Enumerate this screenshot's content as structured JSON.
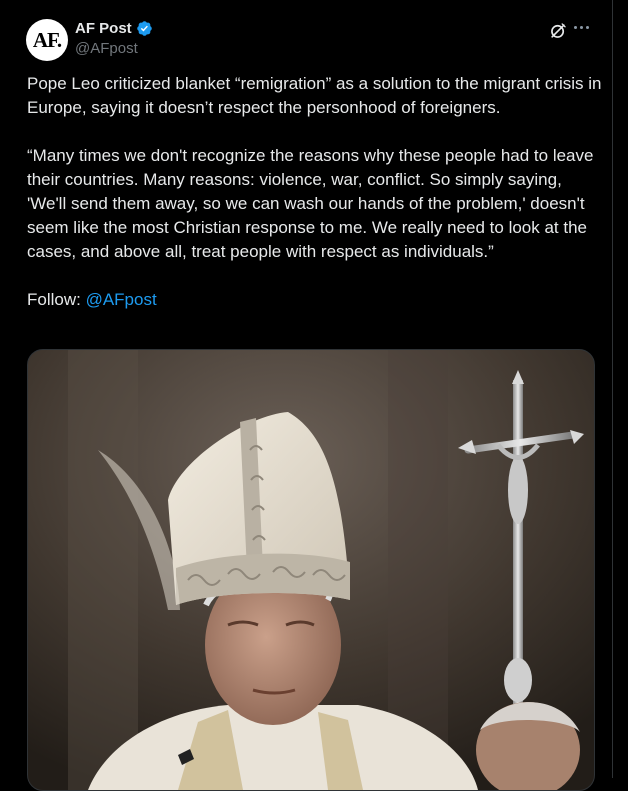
{
  "account": {
    "avatar_text": "AF.",
    "display_name": "AF Post",
    "handle": "@AFpost"
  },
  "tweet": {
    "paragraph1": "Pope Leo criticized blanket “remigration” as a solution to the migrant crisis in Europe, saying it doesn’t respect the personhood of foreigners.",
    "paragraph2": "“Many times we don't recognize the reasons why these people had to leave their countries. Many reasons: violence, war, conflict. So simply saying, 'We'll send them away, so we can wash our hands of the problem,' doesn't seem like the most Christian response to me. We really need to look at the cases, and above all, treat people with respect as individuals.”",
    "follow_label": "Follow: ",
    "follow_mention": "@AFpost"
  },
  "icons": {
    "verified": "verified-badge-icon",
    "grok": "grok-icon",
    "more": "more-options-icon"
  },
  "colors": {
    "background": "#000000",
    "text": "#e7e9ea",
    "secondary": "#71767b",
    "accent": "#1d9bf0"
  }
}
